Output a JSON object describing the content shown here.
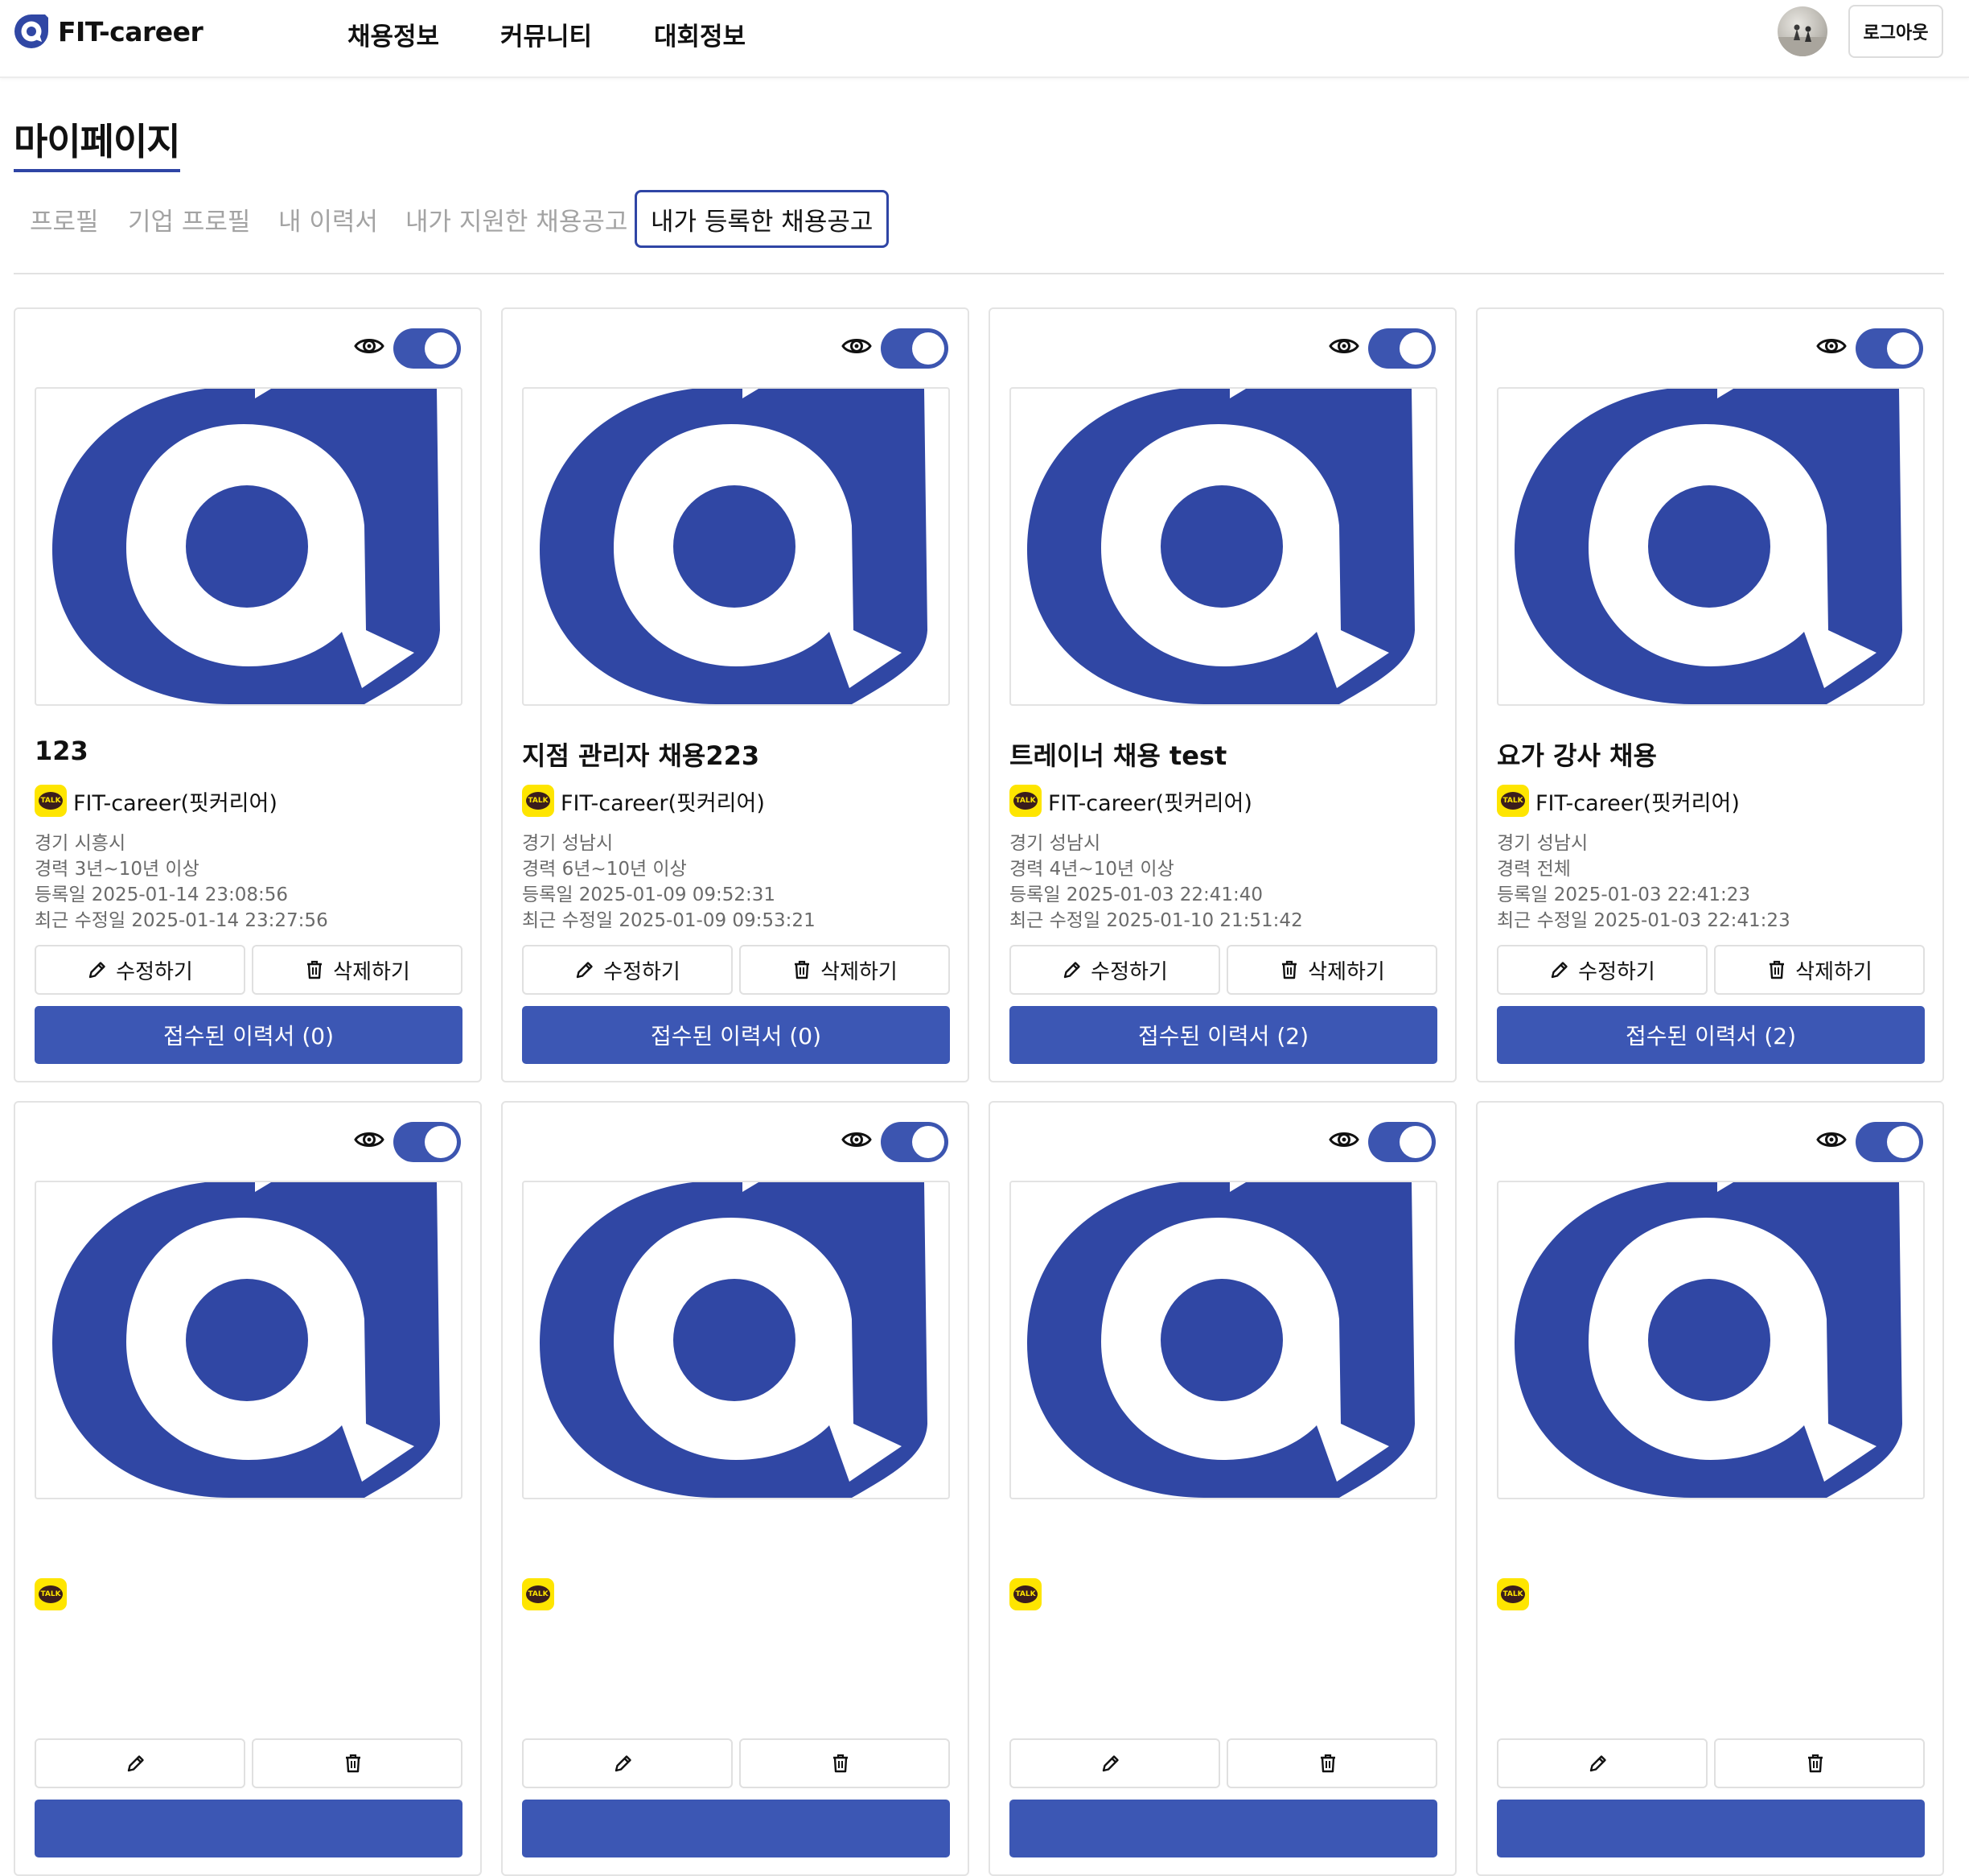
{
  "header": {
    "brand": "FIT-career",
    "nav": [
      "채용정보",
      "커뮤니티",
      "대회정보"
    ],
    "logout_label": "로그아웃"
  },
  "page": {
    "title": "마이페이지",
    "tabs": [
      "프로필",
      "기업 프로필",
      "내 이력서",
      "내가 지원한 채용공고",
      "내가 등록한 채용공고"
    ],
    "active_tab": "내가 등록한 채용공고"
  },
  "colors": {
    "brand_blue": "#3047a4",
    "button_blue": "#3c57b4",
    "kakao_yellow": "#fee500"
  },
  "cards": [
    {
      "title": "123",
      "company": "FIT-career(핏커리어)",
      "location": "경기 시흥시",
      "career": "경력 3년~10년 이상",
      "registered": "등록일 2025-01-14 23:08:56",
      "modified": "최근 수정일 2025-01-14 23:27:56",
      "edit_label": "수정하기",
      "delete_label": "삭제하기",
      "resumes_label": "접수된 이력서 (0)",
      "visible": true
    },
    {
      "title": "지점 관리자 채용223",
      "company": "FIT-career(핏커리어)",
      "location": "경기 성남시",
      "career": "경력 6년~10년 이상",
      "registered": "등록일 2025-01-09 09:52:31",
      "modified": "최근 수정일 2025-01-09 09:53:21",
      "edit_label": "수정하기",
      "delete_label": "삭제하기",
      "resumes_label": "접수된 이력서 (0)",
      "visible": true
    },
    {
      "title": "트레이너 채용 test",
      "company": "FIT-career(핏커리어)",
      "location": "경기 성남시",
      "career": "경력 4년~10년 이상",
      "registered": "등록일 2025-01-03 22:41:40",
      "modified": "최근 수정일 2025-01-10 21:51:42",
      "edit_label": "수정하기",
      "delete_label": "삭제하기",
      "resumes_label": "접수된 이력서 (2)",
      "visible": true
    },
    {
      "title": "요가 강사 채용",
      "company": "FIT-career(핏커리어)",
      "location": "경기 성남시",
      "career": "경력 전체",
      "registered": "등록일 2025-01-03 22:41:23",
      "modified": "최근 수정일 2025-01-03 22:41:23",
      "edit_label": "수정하기",
      "delete_label": "삭제하기",
      "resumes_label": "접수된 이력서 (2)",
      "visible": true
    },
    {
      "visible": true
    },
    {
      "visible": true
    },
    {
      "visible": true
    },
    {
      "visible": true
    }
  ]
}
